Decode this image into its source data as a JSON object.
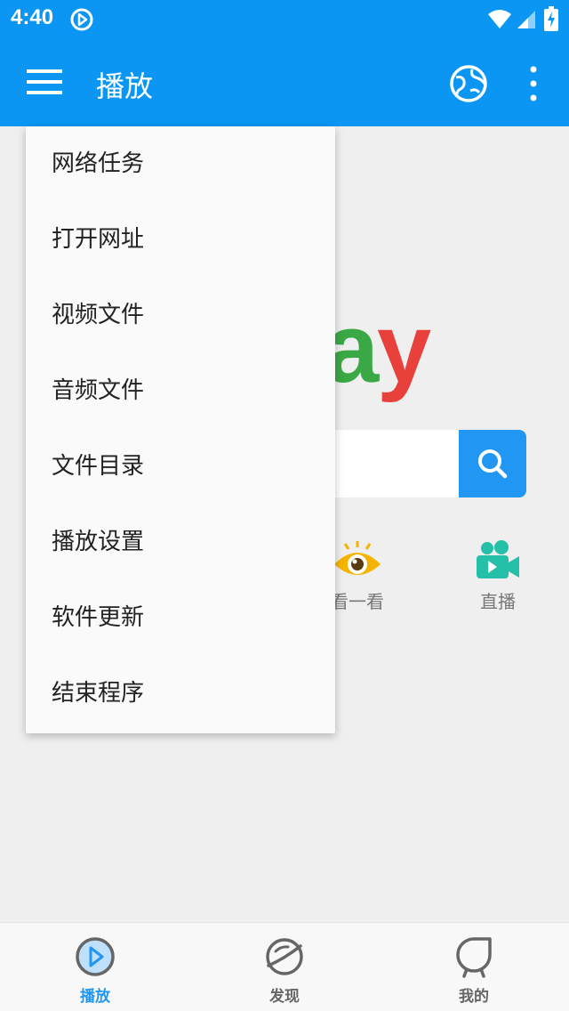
{
  "status_bar": {
    "time": "4:40"
  },
  "app_bar": {
    "title": "播放"
  },
  "dropdown_menu": {
    "items": [
      {
        "label": "网络任务"
      },
      {
        "label": "打开网址"
      },
      {
        "label": "视频文件"
      },
      {
        "label": "音频文件"
      },
      {
        "label": "文件目录"
      },
      {
        "label": "播放设置"
      },
      {
        "label": "软件更新"
      },
      {
        "label": "结束程序"
      }
    ]
  },
  "main": {
    "logo_partial": {
      "letter_a": "a",
      "letter_y": "y"
    },
    "search": {
      "value": "",
      "placeholder": ""
    },
    "quick_links": [
      {
        "label": "看一看",
        "icon": "eye-icon"
      },
      {
        "label": "直播",
        "icon": "video-camera-icon"
      }
    ]
  },
  "bottom_nav": {
    "items": [
      {
        "label": "播放",
        "icon": "play-circle-icon",
        "active": true
      },
      {
        "label": "发现",
        "icon": "planet-icon",
        "active": false
      },
      {
        "label": "我的",
        "icon": "profile-icon",
        "active": false
      }
    ]
  },
  "colors": {
    "primary": "#0b96f4",
    "accent": "#2196f3",
    "logo_green": "#3aa845",
    "logo_red": "#e8413b",
    "eye_yellow": "#f5b400",
    "live_teal": "#26c0a8"
  }
}
